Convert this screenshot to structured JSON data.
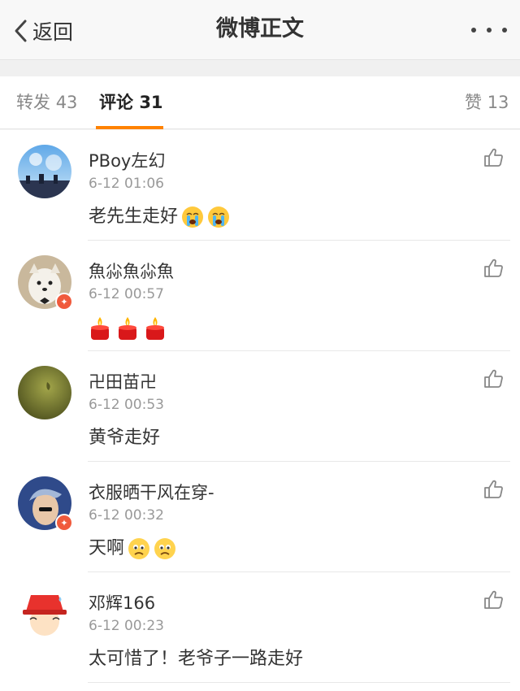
{
  "header": {
    "back_label": "返回",
    "title": "微博正文",
    "back_icon": "chevron-left-icon",
    "more_icon": "more-dots-icon"
  },
  "tabs": {
    "repost_label": "转发",
    "repost_count": "43",
    "comment_label": "评论",
    "comment_count": "31",
    "like_label": "赞",
    "like_count": "13",
    "accent_color": "#ff8200"
  },
  "comments": [
    {
      "username": "PBoy左幻",
      "time": "6-12 01:06",
      "text": "老先生走好",
      "emojis": [
        "crying-face-icon",
        "crying-face-icon"
      ],
      "verified": false
    },
    {
      "username": "魚尛魚尛魚",
      "time": "6-12 00:57",
      "text": "",
      "emojis": [
        "candle-icon",
        "candle-icon",
        "candle-icon"
      ],
      "verified": true
    },
    {
      "username": "卍田苗卍",
      "time": "6-12 00:53",
      "text": "黄爷走好",
      "emojis": [],
      "verified": false
    },
    {
      "username": "衣服晒干风在穿-",
      "time": "6-12 00:32",
      "text": "天啊",
      "emojis": [
        "sad-face-icon",
        "sad-face-icon"
      ],
      "verified": true
    },
    {
      "username": "邓辉166",
      "time": "6-12 00:23",
      "text": "太可惜了！老爷子一路走好",
      "emojis": [],
      "verified": false
    }
  ]
}
